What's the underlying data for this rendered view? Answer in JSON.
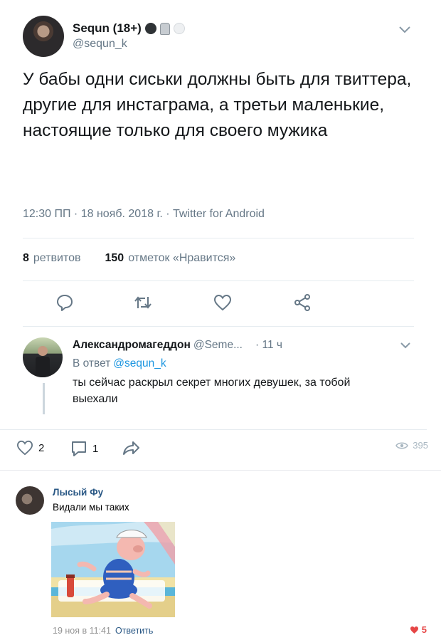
{
  "tweet": {
    "author_name": "Sequn (18+)",
    "author_handle": "@sequn_k",
    "emoji_icons": [
      "new-moon-icon",
      "moai-icon",
      "white-circle-icon"
    ],
    "text": "У бабы одни сиськи должны быть для твиттера, другие для инстаграма, а третьи маленькие, настоящие только для своего мужика",
    "meta": "12:30 ПП · 18 нояб. 2018 г. · Twitter for Android",
    "retweets_count": "8",
    "retweets_label": "ретвитов",
    "likes_count": "150",
    "likes_label": "отметок «Нравится»",
    "actions": [
      "reply-icon",
      "retweet-icon",
      "like-icon",
      "share-icon"
    ]
  },
  "reply": {
    "author_name": "Александромагеддон",
    "author_handle": "@Seme...",
    "time": "· 11 ч",
    "in_reply_prefix": "В ответ",
    "in_reply_handle": "@sequn_k",
    "text": "ты сейчас раскрыл секрет многих девушек, за тобой выехали",
    "likes": "2",
    "comments": "1",
    "views": "395"
  },
  "vk_comment": {
    "author": "Лысый Фу",
    "text": "Видали мы таких",
    "date": "19 ноя в 11:41",
    "reply_label": "Ответить",
    "likes": "5"
  },
  "colors": {
    "twitter_blue": "#1b95e0",
    "vk_link": "#2a5885",
    "like_red": "#e64646"
  }
}
